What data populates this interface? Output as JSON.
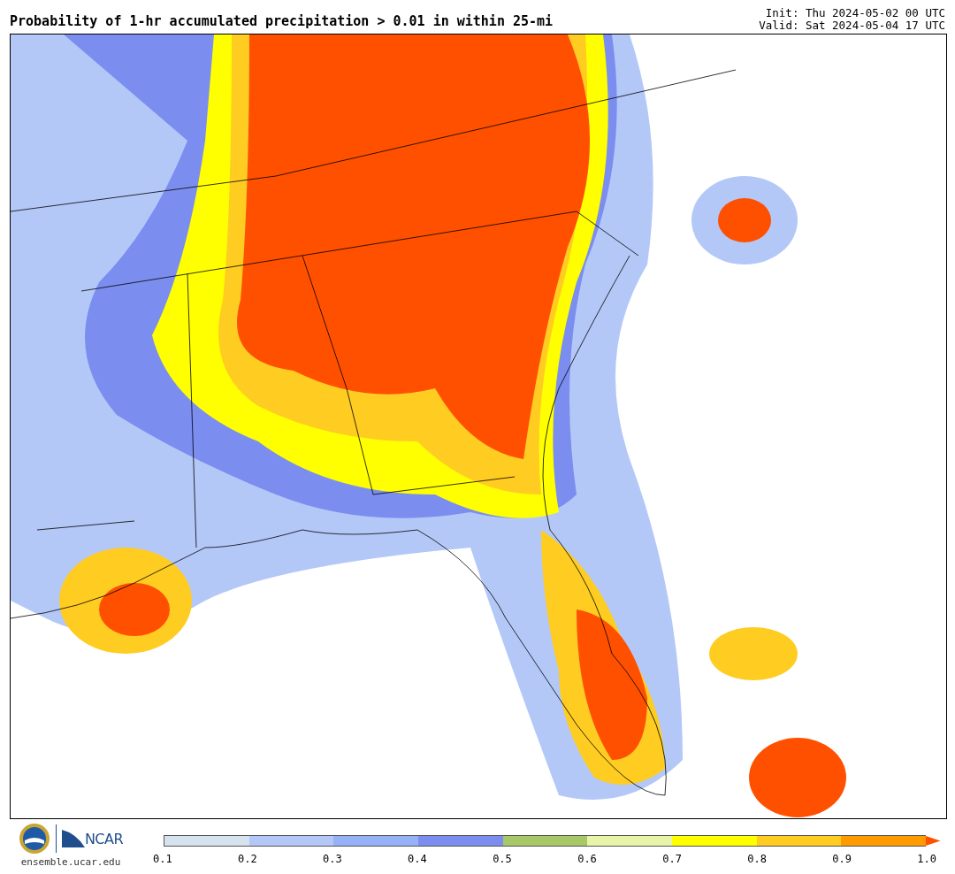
{
  "title": "Probability of 1-hr accumulated precipitation > 0.01 in within 25-mi",
  "init": "Init: Thu 2024-05-02 00 UTC",
  "valid": "Valid: Sat 2024-05-04 17 UTC",
  "footer": {
    "logo_text": "NCAR",
    "url": "ensemble.ucar.edu"
  },
  "colorbar": {
    "bins": [
      {
        "color": "#d6e2ee"
      },
      {
        "color": "#b4c8f8"
      },
      {
        "color": "#96b2f6"
      },
      {
        "color": "#7b8ef0"
      },
      {
        "color": "#a6c866"
      },
      {
        "color": "#e8f5a8"
      },
      {
        "color": "#ffff00"
      },
      {
        "color": "#ffcc22"
      },
      {
        "color": "#ff9a00"
      }
    ],
    "extension": {
      "color": "#ff5000"
    },
    "ticks": [
      "0.1",
      "0.2",
      "0.3",
      "0.4",
      "0.5",
      "0.6",
      "0.7",
      "0.8",
      "0.9",
      "1.0"
    ]
  }
}
